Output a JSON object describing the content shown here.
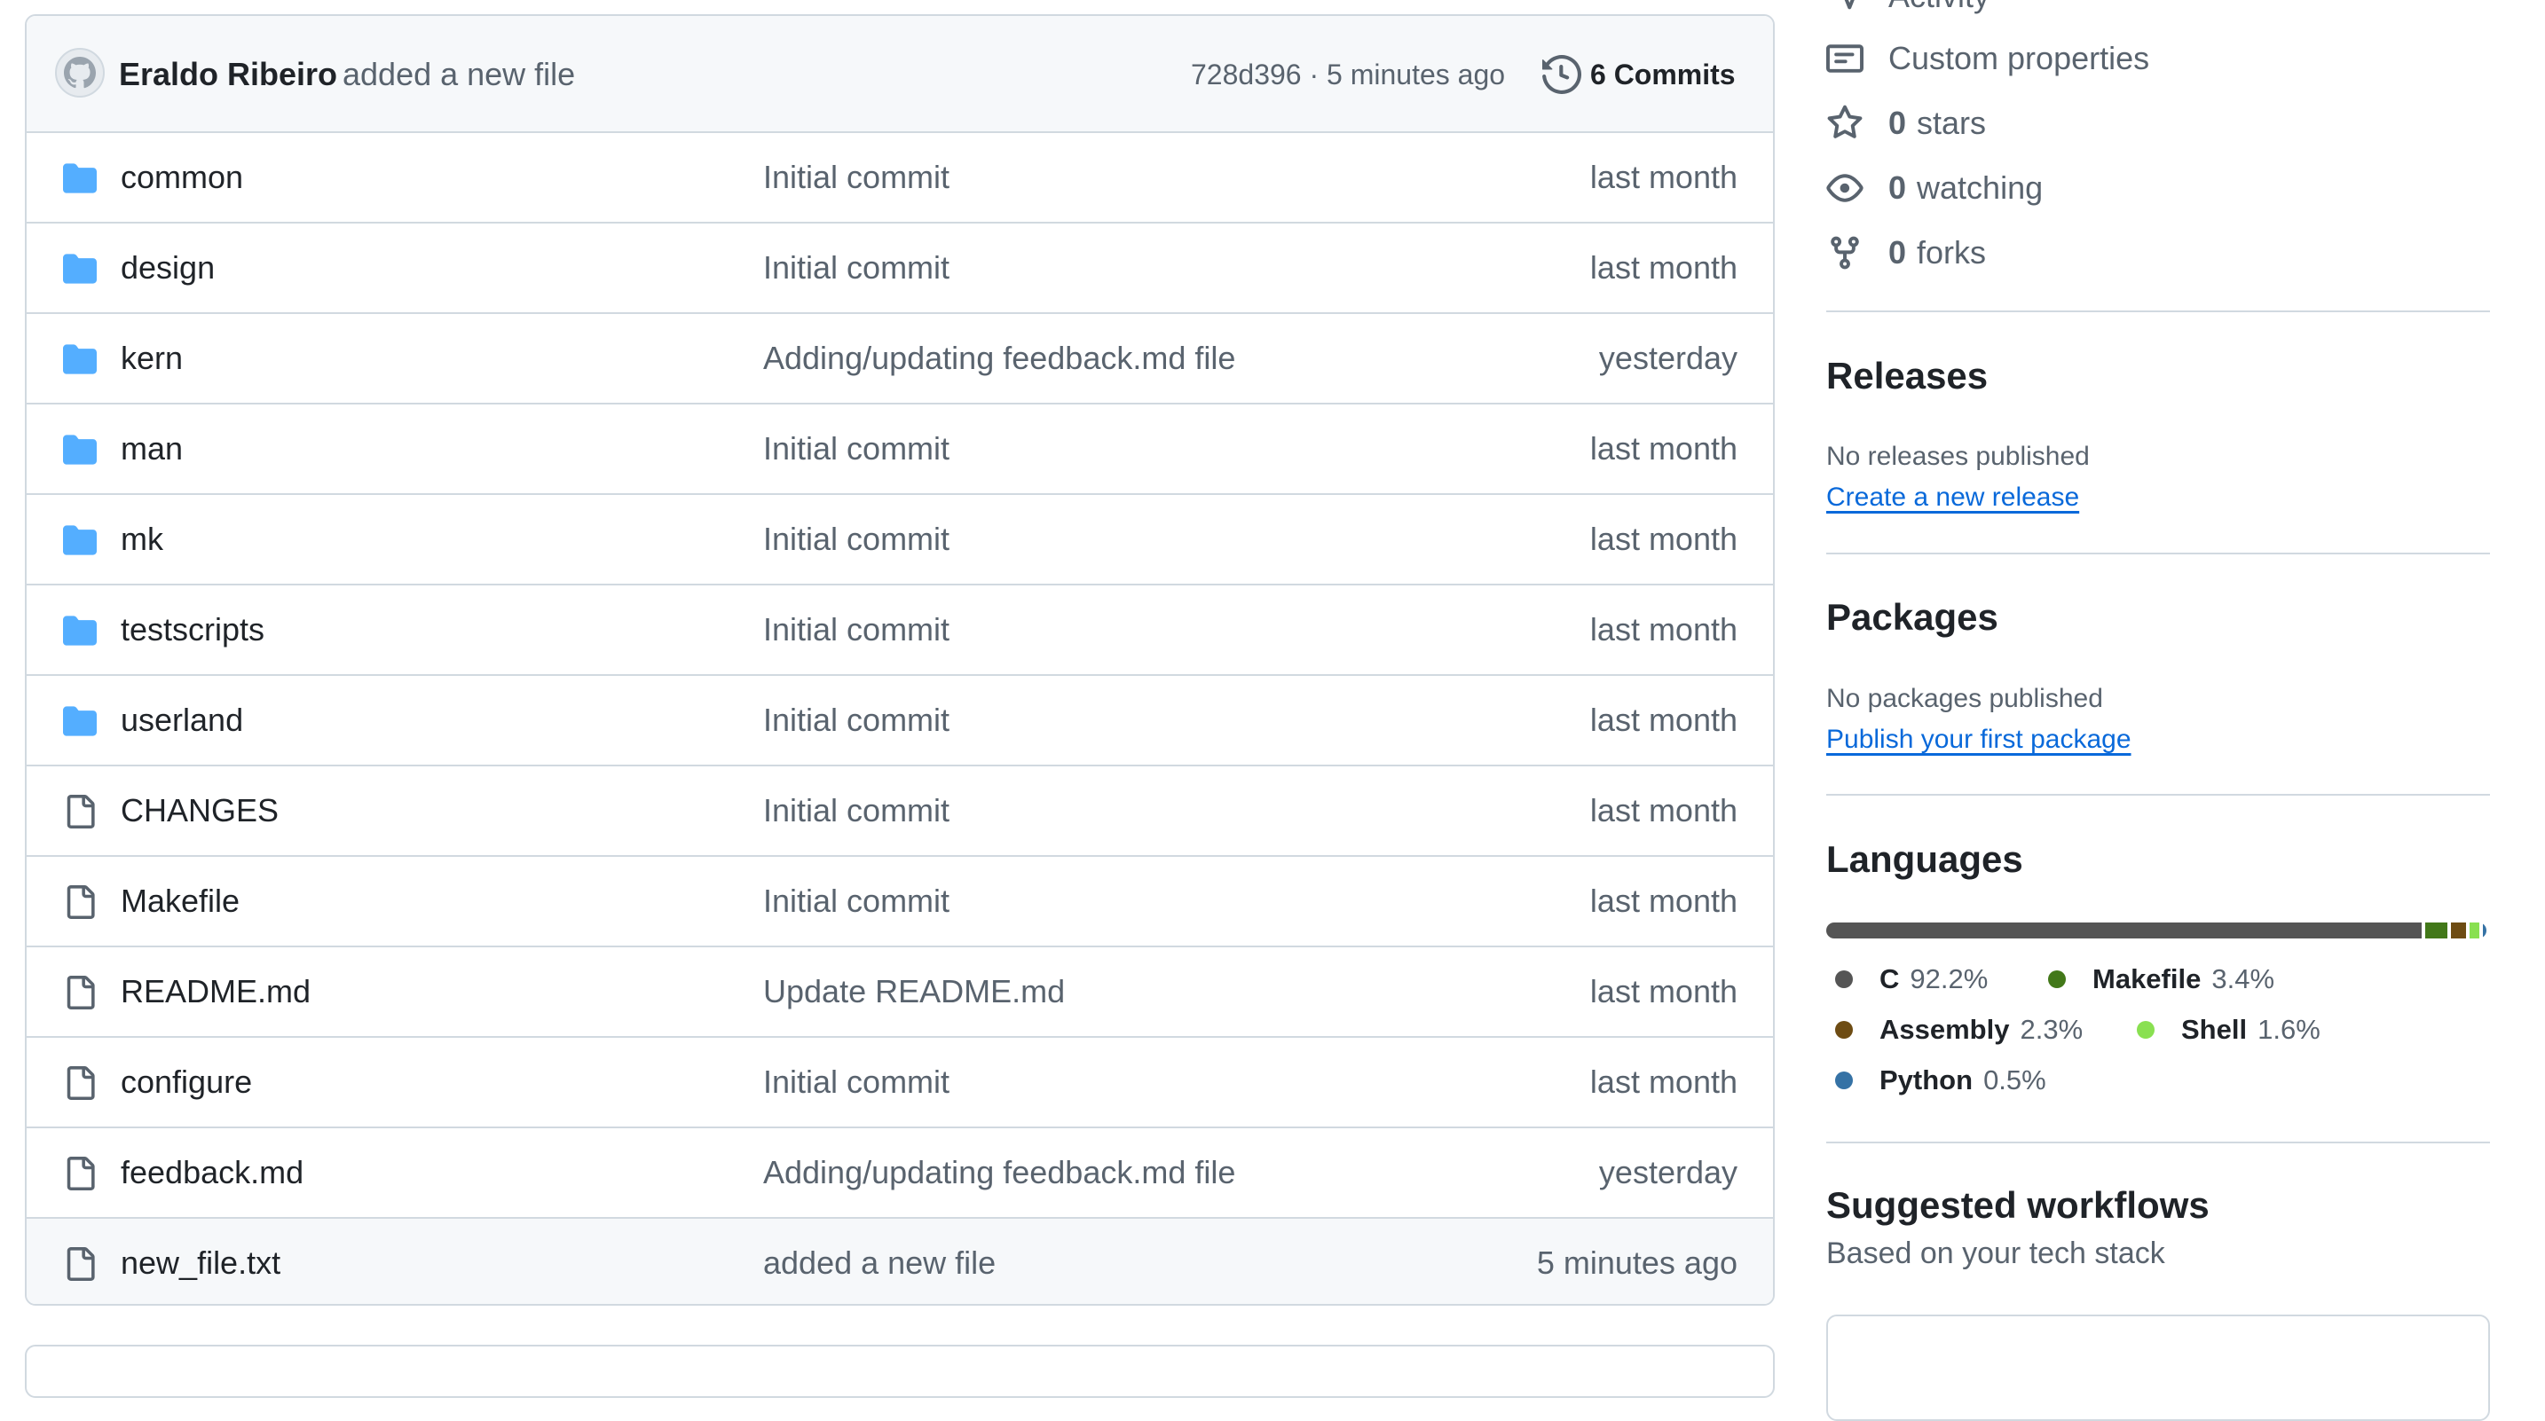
{
  "commit": {
    "author": "Eraldo Ribeiro",
    "message": "added a new file",
    "hash_time": "728d396 · 5 minutes ago",
    "commits_label": "6 Commits"
  },
  "files": [
    {
      "type": "folder",
      "name": "common",
      "message": "Initial commit",
      "time": "last month"
    },
    {
      "type": "folder",
      "name": "design",
      "message": "Initial commit",
      "time": "last month"
    },
    {
      "type": "folder",
      "name": "kern",
      "message": "Adding/updating feedback.md file",
      "time": "yesterday"
    },
    {
      "type": "folder",
      "name": "man",
      "message": "Initial commit",
      "time": "last month"
    },
    {
      "type": "folder",
      "name": "mk",
      "message": "Initial commit",
      "time": "last month"
    },
    {
      "type": "folder",
      "name": "testscripts",
      "message": "Initial commit",
      "time": "last month"
    },
    {
      "type": "folder",
      "name": "userland",
      "message": "Initial commit",
      "time": "last month"
    },
    {
      "type": "file",
      "name": "CHANGES",
      "message": "Initial commit",
      "time": "last month"
    },
    {
      "type": "file",
      "name": "Makefile",
      "message": "Initial commit",
      "time": "last month"
    },
    {
      "type": "file",
      "name": "README.md",
      "message": "Update README.md",
      "time": "last month"
    },
    {
      "type": "file",
      "name": "configure",
      "message": "Initial commit",
      "time": "last month"
    },
    {
      "type": "file",
      "name": "feedback.md",
      "message": "Adding/updating feedback.md file",
      "time": "yesterday"
    },
    {
      "type": "file",
      "name": "new_file.txt",
      "message": "added a new file",
      "time": "5 minutes ago"
    }
  ],
  "sidebar": {
    "activity": "Activity",
    "custom_properties": "Custom properties",
    "stars_count": "0",
    "stars_label": "stars",
    "watching_count": "0",
    "watching_label": "watching",
    "forks_count": "0",
    "forks_label": "forks",
    "releases_title": "Releases",
    "releases_none": "No releases published",
    "releases_link": "Create a new release",
    "packages_title": "Packages",
    "packages_none": "No packages published",
    "packages_link": "Publish your first package",
    "languages_title": "Languages",
    "workflows_title": "Suggested workflows",
    "workflows_sub": "Based on your tech stack"
  },
  "languages": [
    {
      "name": "C",
      "percent": "92.2%",
      "value": 92.2,
      "color": "#555555"
    },
    {
      "name": "Makefile",
      "percent": "3.4%",
      "value": 3.4,
      "color": "#427819"
    },
    {
      "name": "Assembly",
      "percent": "2.3%",
      "value": 2.3,
      "color": "#6e4c13"
    },
    {
      "name": "Shell",
      "percent": "1.6%",
      "value": 1.6,
      "color": "#89e051"
    },
    {
      "name": "Python",
      "percent": "0.5%",
      "value": 0.5,
      "color": "#3572a5"
    }
  ]
}
